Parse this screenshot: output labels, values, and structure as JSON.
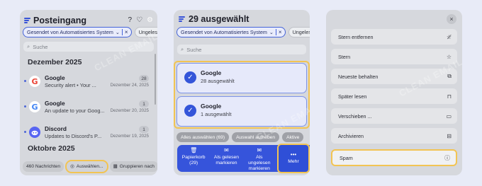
{
  "inbox": {
    "title": "Posteingang",
    "filter_chip": "Gesendet von Automatisiertes System",
    "filter_close": "×",
    "filter_unread": "Ungelesen",
    "search_placeholder": "Suche",
    "sections": [
      "Dezember 2025",
      "Oktobre 2025"
    ],
    "emails": [
      {
        "sender": "Google",
        "preview": "Security alert • Your ...",
        "count": "28",
        "date": "Dezember 24, 2025"
      },
      {
        "sender": "Google",
        "preview": "An update to your Goog...",
        "count": "1",
        "date": "Dezember 20, 2025"
      },
      {
        "sender": "Discord",
        "preview": "Updates to Discord's P...",
        "count": "1",
        "date": "Dezember 19, 2025"
      }
    ],
    "bottom": {
      "messages": "460 Nachrichten",
      "select": "Auswählen...",
      "group": "Gruppieren nach"
    }
  },
  "selection": {
    "title": "29 ausgewählt",
    "filter_chip": "Gesendet von Automatisiertes System",
    "filter_close": "×",
    "filter_unread": "Ungeles",
    "search_placeholder": "Suche",
    "cards": [
      {
        "sender": "Google",
        "sub": "28 ausgewählt"
      },
      {
        "sender": "Google",
        "sub": "1 ausgewählt"
      }
    ],
    "pills": [
      "Alles auswählen (69)",
      "Auswahl aufheben",
      "Aktive"
    ],
    "actions": {
      "trash_line1": "Papierkorb",
      "trash_line2": "(29)",
      "read_line1": "Als gelesen",
      "read_line2": "markieren",
      "unread_line1": "Als",
      "unread_line2": "ungelesen",
      "unread_line3": "markieren",
      "more": "Mehr"
    }
  },
  "menu": {
    "close": "×",
    "items": [
      {
        "label": "Stern entfernen",
        "icon": "star-off-icon"
      },
      {
        "label": "Stern",
        "icon": "star-icon"
      },
      {
        "label": "Neueste behalten",
        "icon": "archive-keep-icon"
      },
      {
        "label": "Später lesen",
        "icon": "bookmark-icon"
      },
      {
        "label": "Verschieben ...",
        "icon": "folder-icon"
      },
      {
        "label": "Archivieren",
        "icon": "archive-icon"
      },
      {
        "label": "Spam",
        "icon": "spam-icon"
      }
    ]
  },
  "watermark": "CLEAN EMAIL",
  "colors": {
    "accent": "#3654db",
    "highlight": "#f2c453",
    "panel": "#d6d8dd",
    "background": "#e8ebf7"
  }
}
